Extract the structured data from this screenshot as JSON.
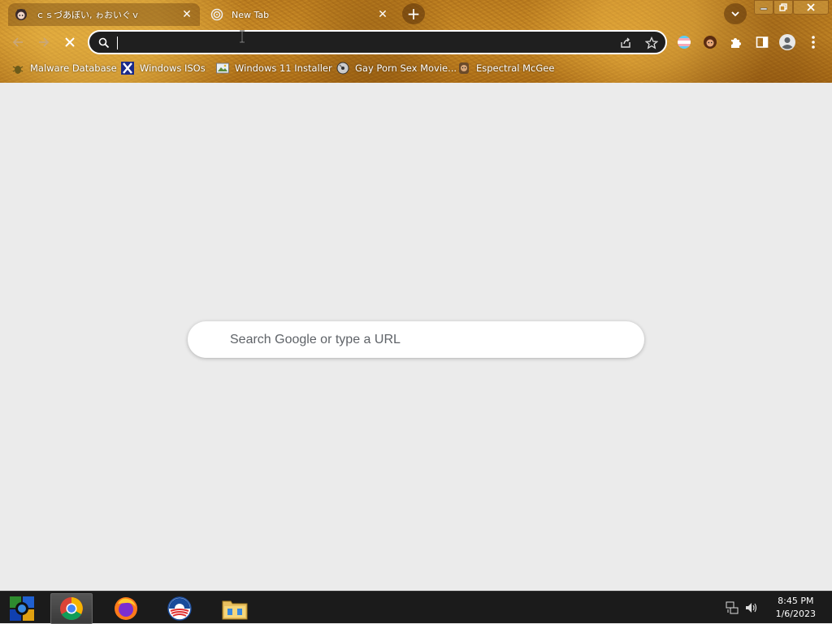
{
  "tabs": [
    {
      "title": "ｃｓづあぼい, ゎおいぐｖ",
      "favicon": "anime-girl-icon",
      "active": true
    },
    {
      "title": "New Tab",
      "favicon": "chrome-newtab-icon",
      "active": false
    }
  ],
  "omnibox": {
    "value": "",
    "placeholder": ""
  },
  "bookmarks": [
    {
      "label": "Malware Database",
      "icon": "bug-icon"
    },
    {
      "label": "Windows ISOs",
      "icon": "x-logo-icon"
    },
    {
      "label": "Windows 11 Installer",
      "icon": "image-icon"
    },
    {
      "label": "Gay Porn Sex Movie...",
      "icon": "cd-icon"
    },
    {
      "label": "Espectral McGee",
      "icon": "face-icon"
    }
  ],
  "ntp": {
    "search_placeholder": "Search Google or type a URL"
  },
  "taskbar": {
    "time": "8:45 PM",
    "date": "1/6/2023"
  },
  "colors": {
    "theme_gold": "#c88a26",
    "omnibox_bg": "#1f1f1f",
    "page_bg": "#ebebeb",
    "taskbar_bg": "#1b1b1b"
  }
}
